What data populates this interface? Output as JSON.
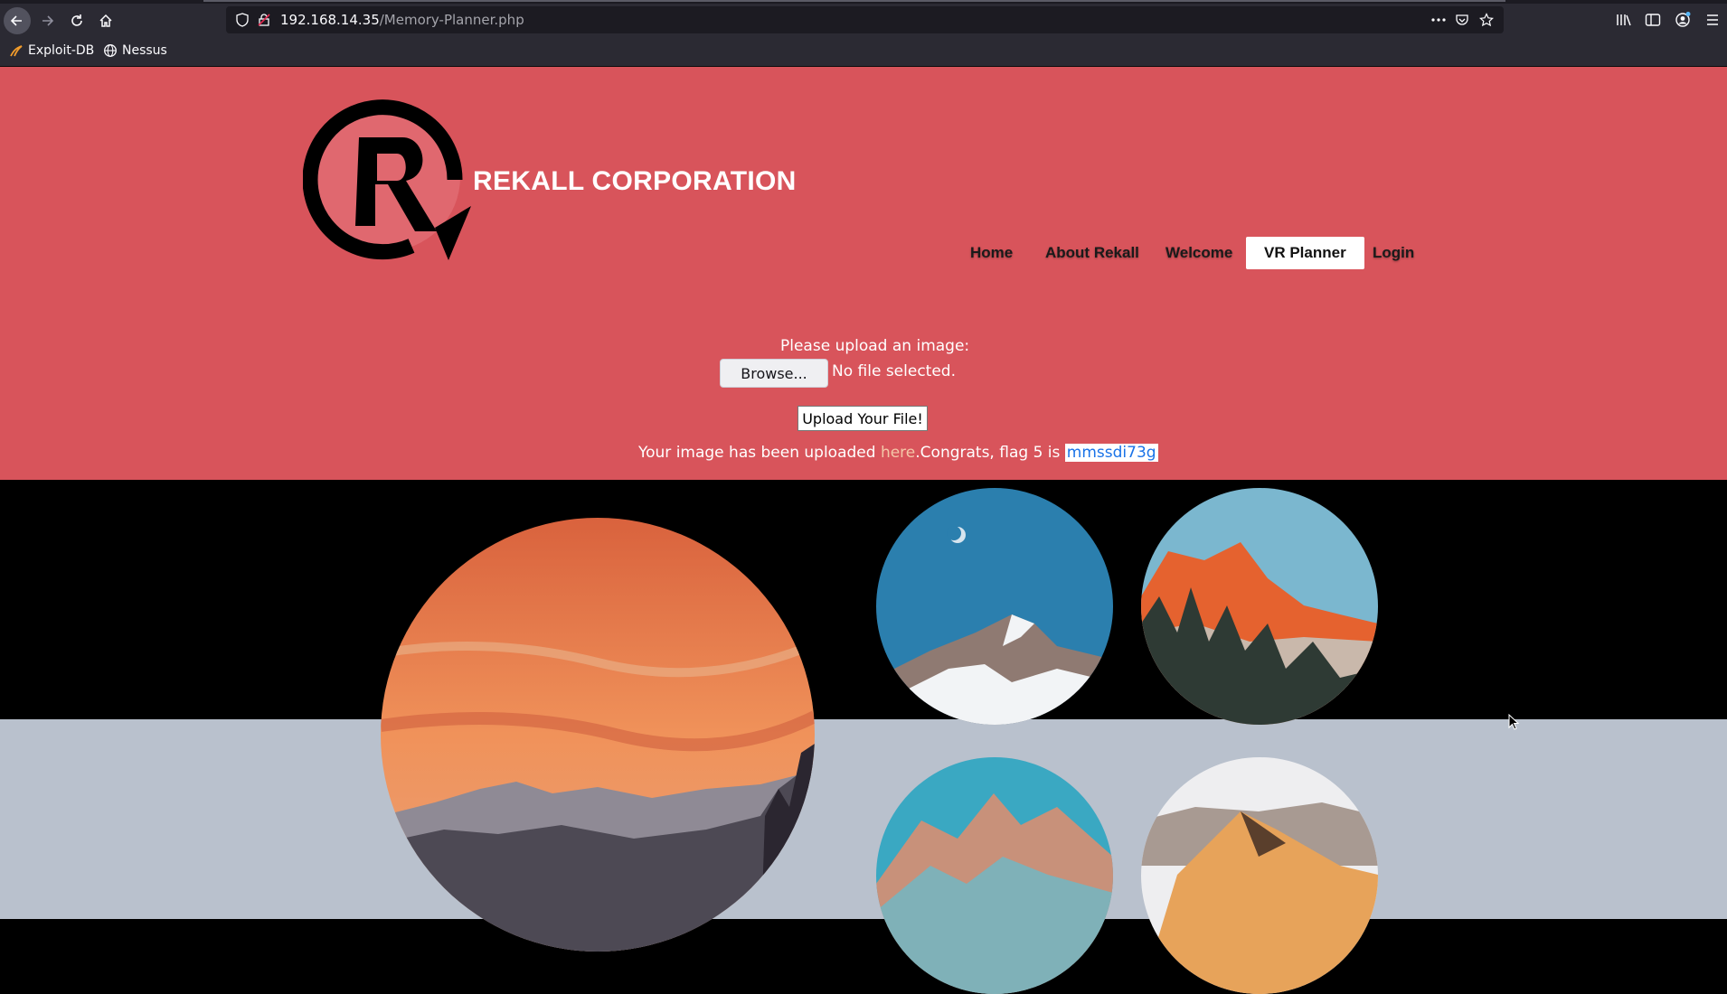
{
  "browser": {
    "url_host": "192.168.14.35",
    "url_path": "/Memory-Planner.php",
    "bookmarks": [
      {
        "label": "Exploit-DB",
        "icon": "exploit-db-icon"
      },
      {
        "label": "Nessus",
        "icon": "globe-icon"
      }
    ]
  },
  "site": {
    "brand": "REKALL CORPORATION",
    "nav": [
      {
        "label": "Home",
        "active": false
      },
      {
        "label": "About Rekall",
        "active": false
      },
      {
        "label": "Welcome",
        "active": false
      },
      {
        "label": "VR Planner",
        "active": true
      },
      {
        "label": "Login",
        "active": false
      }
    ]
  },
  "upload": {
    "prompt": "Please upload an image:",
    "browse_label": "Browse...",
    "file_status": "No file selected.",
    "submit_label": "Upload Your File!",
    "result_prefix": "Your image has been uploaded ",
    "result_link": "here",
    "result_suffix": ".Congrats, flag 5 is ",
    "flag_value": "mmssdi73g"
  },
  "colors": {
    "hero_bg": "#d8545b",
    "band_grey": "#b9c1cd"
  },
  "gallery": [
    {
      "name": "sunset-mountains"
    },
    {
      "name": "blue-sky-moon-peak"
    },
    {
      "name": "orange-cliffs-forest"
    },
    {
      "name": "turquoise-peaks"
    },
    {
      "name": "snowy-ridge-sunrise"
    }
  ]
}
